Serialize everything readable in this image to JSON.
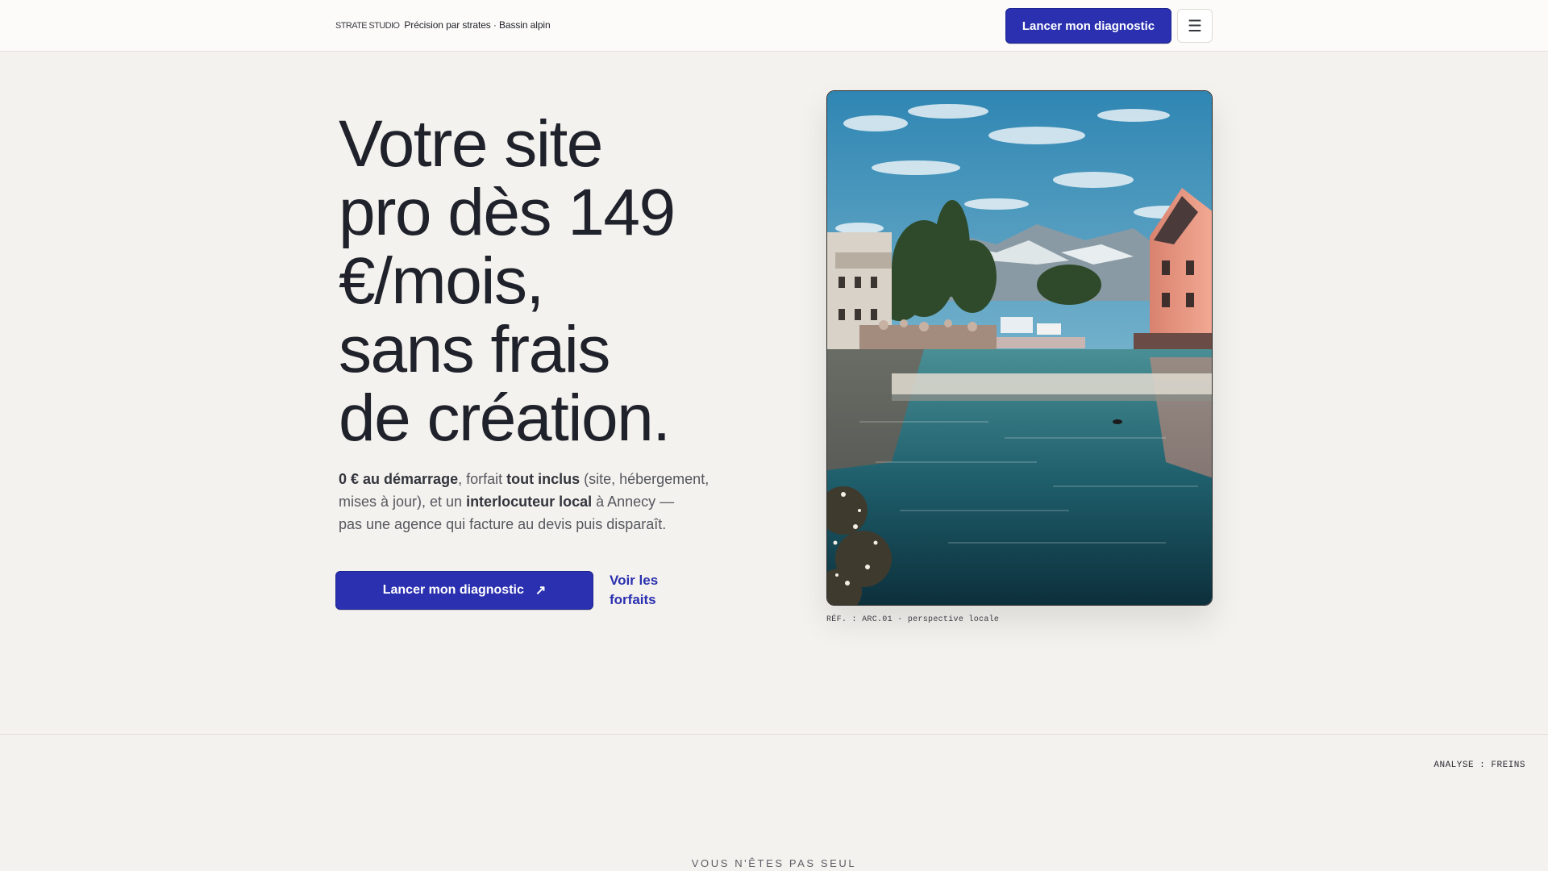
{
  "header": {
    "brand_logo": "STRATE STUDIO",
    "brand_tagline": "Précision par strates · Bassin alpin",
    "cta_label": "Lancer mon diagnostic",
    "menu_icon": "hamburger-menu-icon"
  },
  "hero": {
    "title_lines": [
      "Votre site",
      "pro dès 149",
      "€/mois,",
      "sans frais",
      "de création."
    ],
    "text": {
      "l1_b1": "0 € au démarrage",
      "l1_t1": ", forfait ",
      "l1_b2": "tout inclus",
      "l1_t2": " (site, hébergement,",
      "l2_t1": "mises à jour), et un ",
      "l2_b1": "interlocuteur local",
      "l2_t2": " à Annecy —",
      "l3": "pas une agence qui facture au devis puis disparaît."
    },
    "cta_label": "Lancer mon diagnostic",
    "cta_icon": "arrow-up-right-icon",
    "secondary_link": "Voir les forfaits"
  },
  "photo": {
    "caption": "RÉF. : ARC.01 · perspective locale"
  },
  "section": {
    "tag": "ANALYSE : FREINS",
    "eyebrow": "VOUS N'ÊTES PAS SEUL"
  },
  "colors": {
    "accent": "#2a30b0",
    "background": "#f4f2ee",
    "text": "#20222b"
  }
}
